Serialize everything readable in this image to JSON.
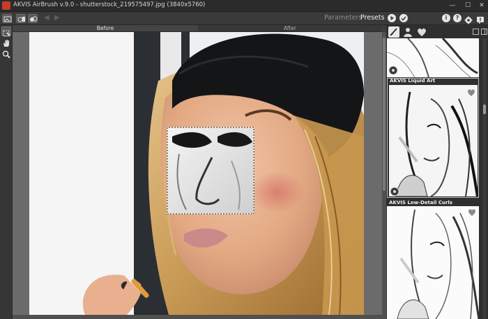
{
  "window": {
    "title": "AKVIS AirBrush v.9.0 - shutterstock_219575497.jpg (3840x5760)",
    "controls": [
      "—",
      "☐",
      "✕"
    ]
  },
  "toolbar": {
    "nav_prev": "◀",
    "nav_next": "▶",
    "tab_parameters": "Parameters",
    "tab_presets": "Presets",
    "run_icon": "play-icon",
    "apply_icon": "check-icon",
    "info_label": "i",
    "help_label": "?",
    "settings_icon": "gear-icon",
    "notify_icon": "notification-icon"
  },
  "view_tabs": {
    "before": "Before",
    "after": "After"
  },
  "tools": [
    "selection-brush-icon",
    "hand-icon",
    "zoom-icon"
  ],
  "presets_panel": {
    "tabs": [
      "artistic-presets-icon",
      "user-presets-icon",
      "favorites-heart-icon"
    ],
    "view_icons": [
      "list-view-icon",
      "grid-view-icon"
    ],
    "items": [
      {
        "name": ""
      },
      {
        "name": "AKVIS Liquid Art"
      },
      {
        "name": "AKVIS Low-Detail Curls"
      }
    ]
  },
  "colors": {
    "accent": "#c63b2a",
    "selection_border": "#ffffff",
    "presets_active": "#ededed"
  }
}
